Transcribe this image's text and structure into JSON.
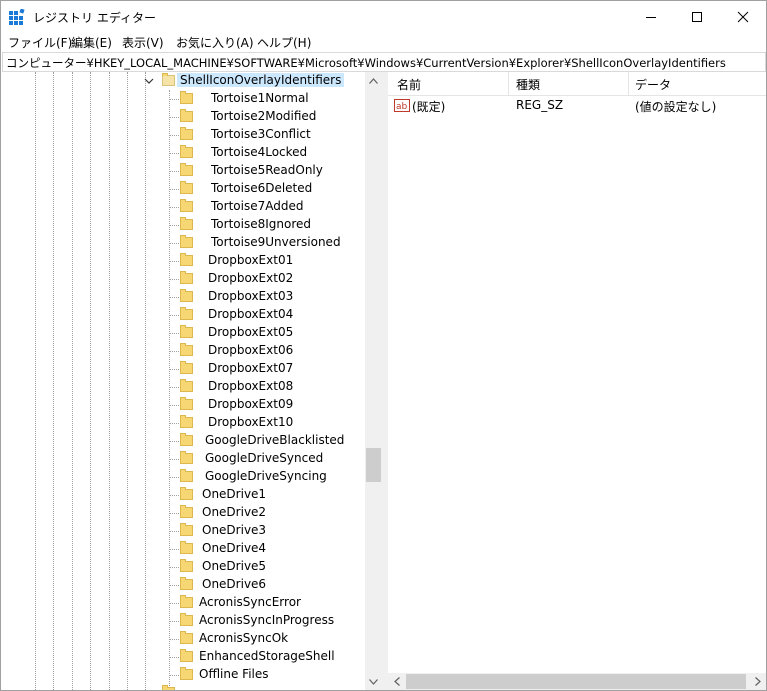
{
  "window": {
    "title": "レジストリ エディター",
    "app_icon": "registry-editor-icon",
    "controls": [
      "minimize-icon",
      "maximize-icon",
      "close-icon"
    ]
  },
  "menu": [
    "ファイル(F)",
    "編集(E)",
    "表示(V)",
    "お気に入り(A)",
    "ヘルプ(H)"
  ],
  "address": "コンピューター¥HKEY_LOCAL_MACHINE¥SOFTWARE¥Microsoft¥Windows¥CurrentVersion¥Explorer¥ShellIconOverlayIdentifiers",
  "tree": {
    "selected": "ShellIconOverlayIdentifiers",
    "children": [
      " Tortoise1Normal",
      " Tortoise2Modified",
      " Tortoise3Conflict",
      " Tortoise4Locked",
      " Tortoise5ReadOnly",
      " Tortoise6Deleted",
      " Tortoise7Added",
      " Tortoise8Ignored",
      " Tortoise9Unversioned",
      " DropboxExt01",
      " DropboxExt02",
      " DropboxExt03",
      " DropboxExt04",
      " DropboxExt05",
      " DropboxExt06",
      " DropboxExt07",
      " DropboxExt08",
      " DropboxExt09",
      " DropboxExt10",
      " GoogleDriveBlacklisted",
      " GoogleDriveSynced",
      " GoogleDriveSyncing",
      " OneDrive1",
      " OneDrive2",
      " OneDrive3",
      " OneDrive4",
      " OneDrive5",
      " OneDrive6",
      "AcronisSyncError",
      "AcronisSyncInProgress",
      "AcronisSyncOk",
      "EnhancedStorageShell",
      "Offline Files"
    ]
  },
  "list": {
    "columns": [
      "名前",
      "種類",
      "データ"
    ],
    "rows": [
      {
        "icon": "string-value-icon",
        "name": "(既定)",
        "type": "REG_SZ",
        "data": "(値の設定なし)"
      }
    ]
  },
  "colors": {
    "selection": "#cce8ff",
    "folder": "#f7d774",
    "scrollbar": "#f0f0f0"
  }
}
